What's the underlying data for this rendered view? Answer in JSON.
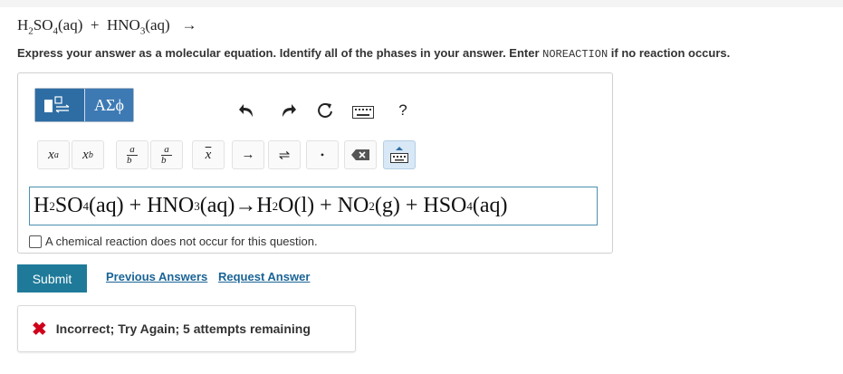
{
  "question": {
    "reactant1": "H",
    "r1_sub1": "2",
    "r1_mid": "SO",
    "r1_sub2": "4",
    "r1_phase": "(aq)",
    "plus": "+",
    "reactant2": "HNO",
    "r2_sub": "3",
    "r2_phase": "(aq)",
    "arrow": "→"
  },
  "instructions": {
    "part1": "Express your answer as a molecular equation. Identify all of the phases in your answer. Enter ",
    "code": "NOREACTION",
    "part2": " if no reaction occurs."
  },
  "toolbar": {
    "greek_label": "ΑΣϕ",
    "help_label": "?",
    "superscript_label": "xᵃ",
    "subscript_label": "x_b",
    "fraction_a": "a",
    "fraction_b": "b",
    "overline_label": "x",
    "arrow_label": "→",
    "equilibrium_label": "⇌",
    "dot_label": "•"
  },
  "answer": {
    "p1": "H",
    "s1": "2",
    "p2": "SO",
    "s2": "4",
    "p3": "(aq) + HNO",
    "s3": "3",
    "p4": "(aq)→H",
    "s4": "2",
    "p5": "O(l) + NO",
    "s5": "2",
    "p6": "(g) + HSO",
    "s6": "4",
    "p7": "(aq)"
  },
  "no_reaction_label": "A chemical reaction does not occur for this question.",
  "submit_label": "Submit",
  "previous_answers_label": "Previous Answers",
  "request_answer_label": "Request Answer",
  "feedback": {
    "icon": "close-icon",
    "text": "Incorrect; Try Again; 5 attempts remaining"
  },
  "colors": {
    "submit_bg": "#1f7a99",
    "link": "#1a6496",
    "error": "#d0021b",
    "active_tab": "#2e6da4"
  }
}
